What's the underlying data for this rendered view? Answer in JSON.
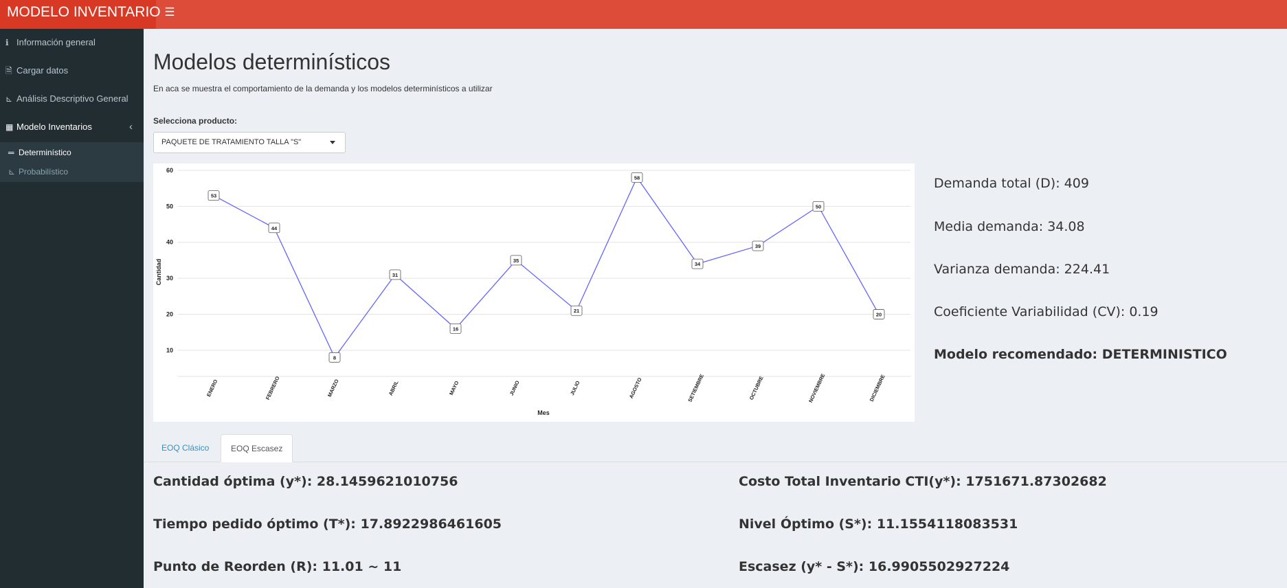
{
  "app": {
    "title": "MODELO INVENTARIO",
    "menu_toggle_icon": "hamburger-icon"
  },
  "sidebar": {
    "items": [
      {
        "label": "Información general",
        "icon": "info-icon"
      },
      {
        "label": "Cargar datos",
        "icon": "file-icon"
      },
      {
        "label": "Análisis Descriptivo General",
        "icon": "line-chart-icon"
      },
      {
        "label": "Modelo Inventarios",
        "icon": "warehouse-icon"
      }
    ],
    "subitems": [
      {
        "label": "Determinístico",
        "icon": "bars-icon",
        "active": true
      },
      {
        "label": "Probabilístico",
        "icon": "line-chart-icon",
        "active": false
      }
    ]
  },
  "page": {
    "title": "Modelos determinísticos",
    "subtitle": "En aca se muestra el comportamiento de la demanda y los modelos determinísticos a utilizar",
    "select_label": "Selecciona producto:",
    "selected_product": "PAQUETE DE TRATAMIENTO TALLA \"S\""
  },
  "stats": {
    "demanda_total": "Demanda total (D): 409",
    "media": "Media demanda: 34.08",
    "varianza": "Varianza demanda: 224.41",
    "cv": "Coeficiente Variabilidad (CV): 0.19",
    "modelo": "Modelo recomendado: DETERMINISTICO"
  },
  "tabs": [
    {
      "label": "EOQ Clásico",
      "active": false
    },
    {
      "label": "EOQ Escasez",
      "active": true
    }
  ],
  "results": {
    "cantidad": "Cantidad óptima (y*): 28.1459621010756",
    "tiempo": "Tiempo pedido óptimo (T*): 17.8922986461605",
    "reorden": "Punto de Reorden (R): 11.01 ~ 11",
    "costo": "Costo Total Inventario CTI(y*): 1751671.87302682",
    "nivel": "Nivel Óptimo (S*): 11.1554118083531",
    "escasez": "Escasez (y* - S*): 16.9905502927224"
  },
  "colors": {
    "topbar": "#dd4b39",
    "sidebar": "#222d32",
    "line": "#6464ff",
    "link": "#3c8dbc"
  },
  "chart_data": {
    "type": "line",
    "title": "",
    "xlabel": "Mes",
    "ylabel": "Cantidad",
    "categories": [
      "ENERO",
      "FEBRERO",
      "MARZO",
      "ABRIL",
      "MAYO",
      "JUNIO",
      "JULIO",
      "AGOSTO",
      "SETIEMBRE",
      "OCTUBRE",
      "NOVIEMBRE",
      "DICIEMBRE"
    ],
    "values": [
      53,
      44,
      8,
      31,
      16,
      35,
      21,
      58,
      34,
      39,
      50,
      20
    ],
    "yticks": [
      10,
      20,
      30,
      40,
      50,
      60
    ],
    "ylim": [
      5,
      60
    ],
    "grid": true,
    "data_labels": true
  }
}
